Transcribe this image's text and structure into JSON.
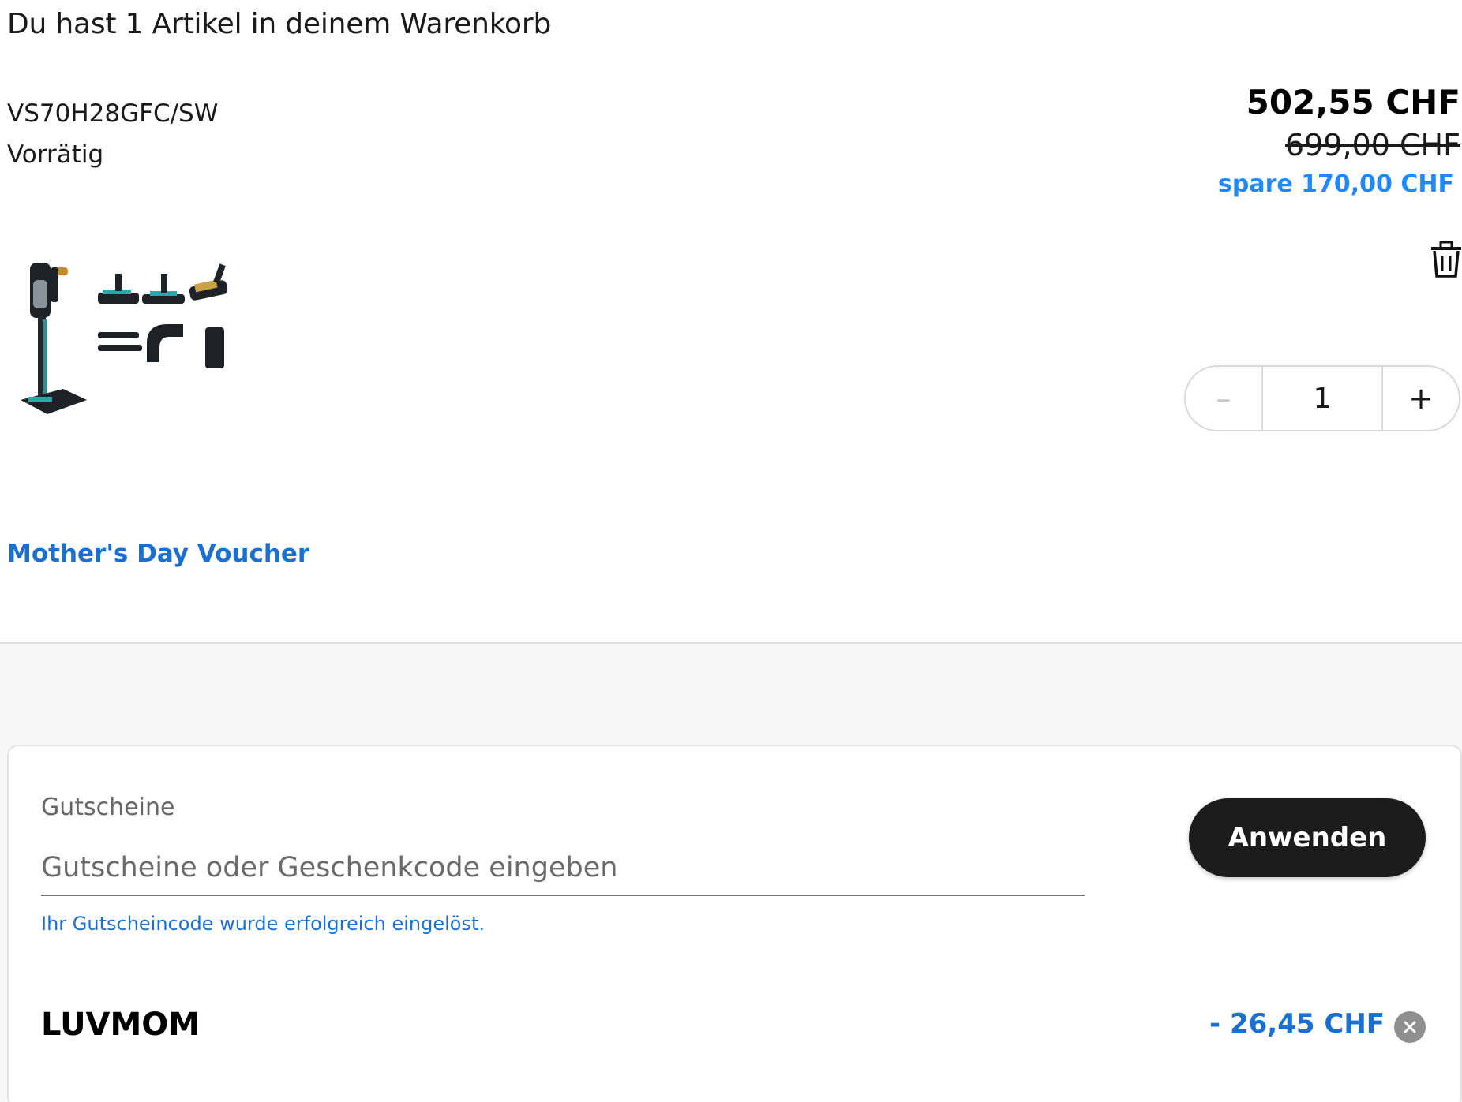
{
  "cart": {
    "title": "Du hast 1 Artikel in deinem Warenkorb",
    "item": {
      "sku": "VS70H28GFC/SW",
      "stock_status": "Vorrätig",
      "price_current": "502,55 CHF",
      "price_old": "699,00 CHF",
      "price_saving": "spare 170,00 CHF",
      "quantity": "1",
      "minus_label": "–",
      "plus_label": "+"
    },
    "promotion_link": "Mother's Day Voucher"
  },
  "voucher": {
    "label": "Gutscheine",
    "placeholder": "Gutscheine oder Geschenkcode eingeben",
    "apply_label": "Anwenden",
    "success_message": "Ihr Gutscheincode wurde erfolgreich eingelöst.",
    "applied_code": "LUVMOM",
    "applied_discount": "- 26,45 CHF"
  },
  "icons": {
    "delete": "trash-icon",
    "remove_code": "close-circle-icon",
    "product": "product-image"
  },
  "colors": {
    "accent_blue": "#1a6fd0",
    "saving_blue": "#2189ff",
    "apply_button": "#1c1c1c",
    "section_background": "#f7f7f7"
  }
}
